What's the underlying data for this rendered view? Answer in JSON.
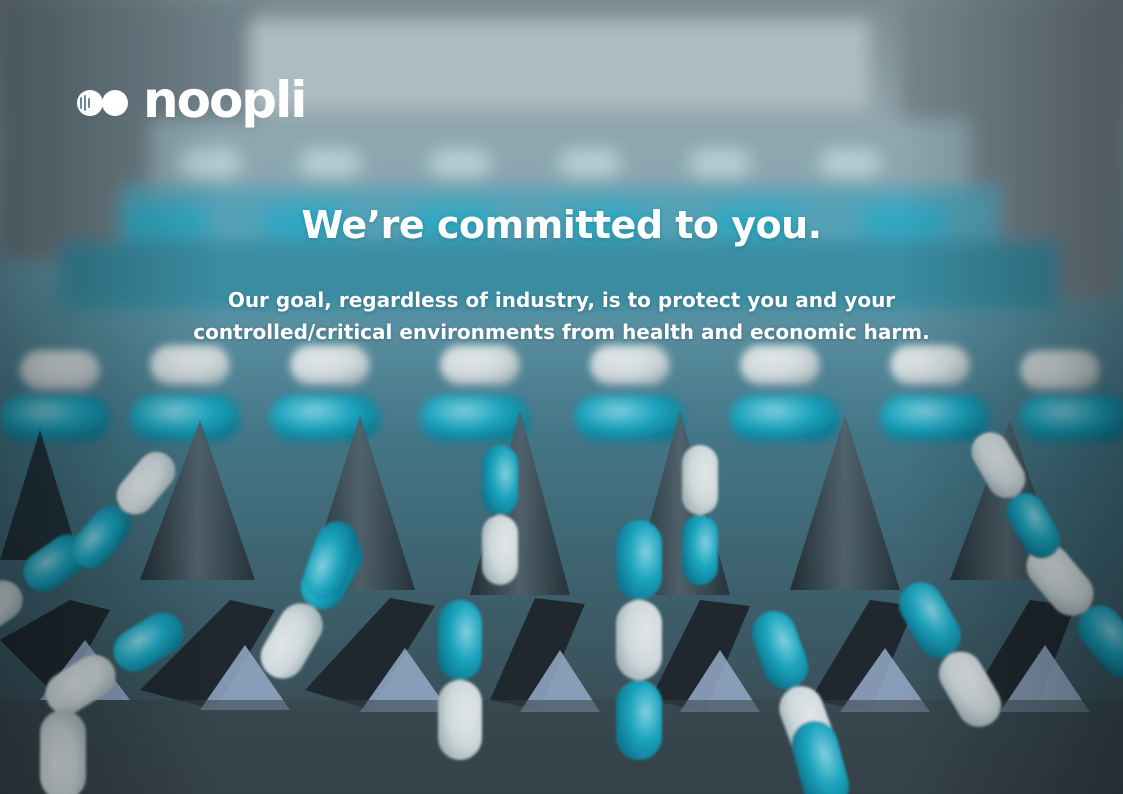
{
  "brand": {
    "name": "noopli",
    "logo_icon": "noopli-logo-mark"
  },
  "hero": {
    "headline": "We’re committed to you.",
    "subtext_line1": "Our goal, regardless of industry, is to protect you and your",
    "subtext_line2": "controlled/critical environments from health and economic harm."
  },
  "colors": {
    "text": "#ffffff",
    "capsule_blue": "#1fb4cf",
    "capsule_white": "#f2f6f5",
    "rail_dark": "#2b3138"
  },
  "background": {
    "description_icon": "pharmaceutical-capsule-conveyor-photo"
  }
}
